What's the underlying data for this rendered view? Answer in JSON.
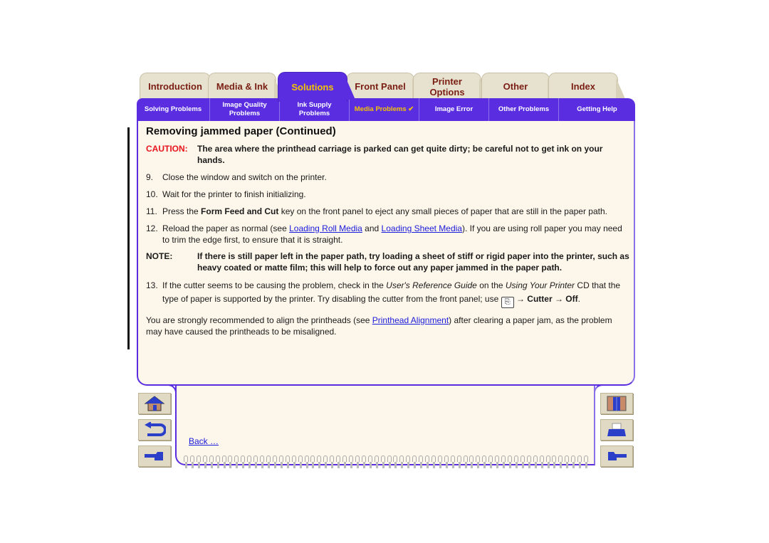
{
  "tabs": [
    {
      "label": "Introduction",
      "active": false
    },
    {
      "label": "Media & Ink",
      "active": false
    },
    {
      "label": "Solutions",
      "active": true
    },
    {
      "label": "Front Panel",
      "active": false
    },
    {
      "label": "Printer Options",
      "active": false
    },
    {
      "label": "Other",
      "active": false
    },
    {
      "label": "Index",
      "active": false
    }
  ],
  "subnav": [
    {
      "label": "Solving Problems"
    },
    {
      "label": "Image Quality Problems"
    },
    {
      "label": "Ink Supply Problems"
    },
    {
      "label": "Media Problems ✔",
      "active": true
    },
    {
      "label": "Image Error"
    },
    {
      "label": "Other Problems"
    },
    {
      "label": "Getting Help"
    }
  ],
  "colors": {
    "accent": "#5a2ee0",
    "active_tab_text": "#f5c400",
    "caution": "#e8141d",
    "link": "#1a1adb",
    "panel_bg": "#fdf6ea"
  },
  "page": {
    "title": "Removing jammed paper (Continued)",
    "caution": {
      "label": "CAUTION:",
      "text": "The area where the printhead carriage is parked can get quite dirty; be careful not to get ink on your hands."
    },
    "step9": {
      "num": "9.",
      "text": "Close the window and switch on the printer."
    },
    "step10": {
      "num": "10.",
      "text": "Wait for the printer to finish initializing."
    },
    "step11": {
      "num": "11.",
      "pre": "Press the ",
      "bold": "Form Feed and Cut",
      "post": " key on the front panel to eject any small pieces of paper that are still in the paper path."
    },
    "step12": {
      "num": "12.",
      "pre": "Reload the paper as normal (see ",
      "link1": "Loading Roll Media",
      "mid": " and ",
      "link2": "Loading Sheet Media",
      "post": "). If you are using roll paper you may need to trim the edge first, to ensure that it is straight."
    },
    "note": {
      "label": "NOTE:",
      "text": "If there is still paper left in the paper path, try loading a sheet of stiff or rigid paper into the printer, such as heavy coated or matte film; this will help to force out any paper jammed in the paper path."
    },
    "step13": {
      "num": "13.",
      "pre": " If the cutter seems to be causing the problem, check in the ",
      "italic1": "User's Reference Guide",
      "mid": " on the ",
      "italic2": "Using Your Printer",
      "mid2": " CD that the type of paper is supported by the printer.  Try disabling the cutter from the front panel; use ",
      "icon": "front-panel-icon",
      "arrow1": " → ",
      "bold1": "Cutter",
      "arrow2": " → ",
      "bold2": "Off",
      "end": "."
    },
    "final": {
      "pre": "You are strongly recommended to align the printheads (see ",
      "link": "Printhead Alignment",
      "post": ") after clearing a paper jam, as the problem may have caused the printheads to be misaligned."
    }
  },
  "nav": {
    "back_link": "Back …",
    "left_buttons": [
      "home-icon",
      "back-arrow-icon",
      "previous-page-icon"
    ],
    "right_buttons": [
      "exit-door-icon",
      "print-icon",
      "next-page-icon"
    ]
  }
}
